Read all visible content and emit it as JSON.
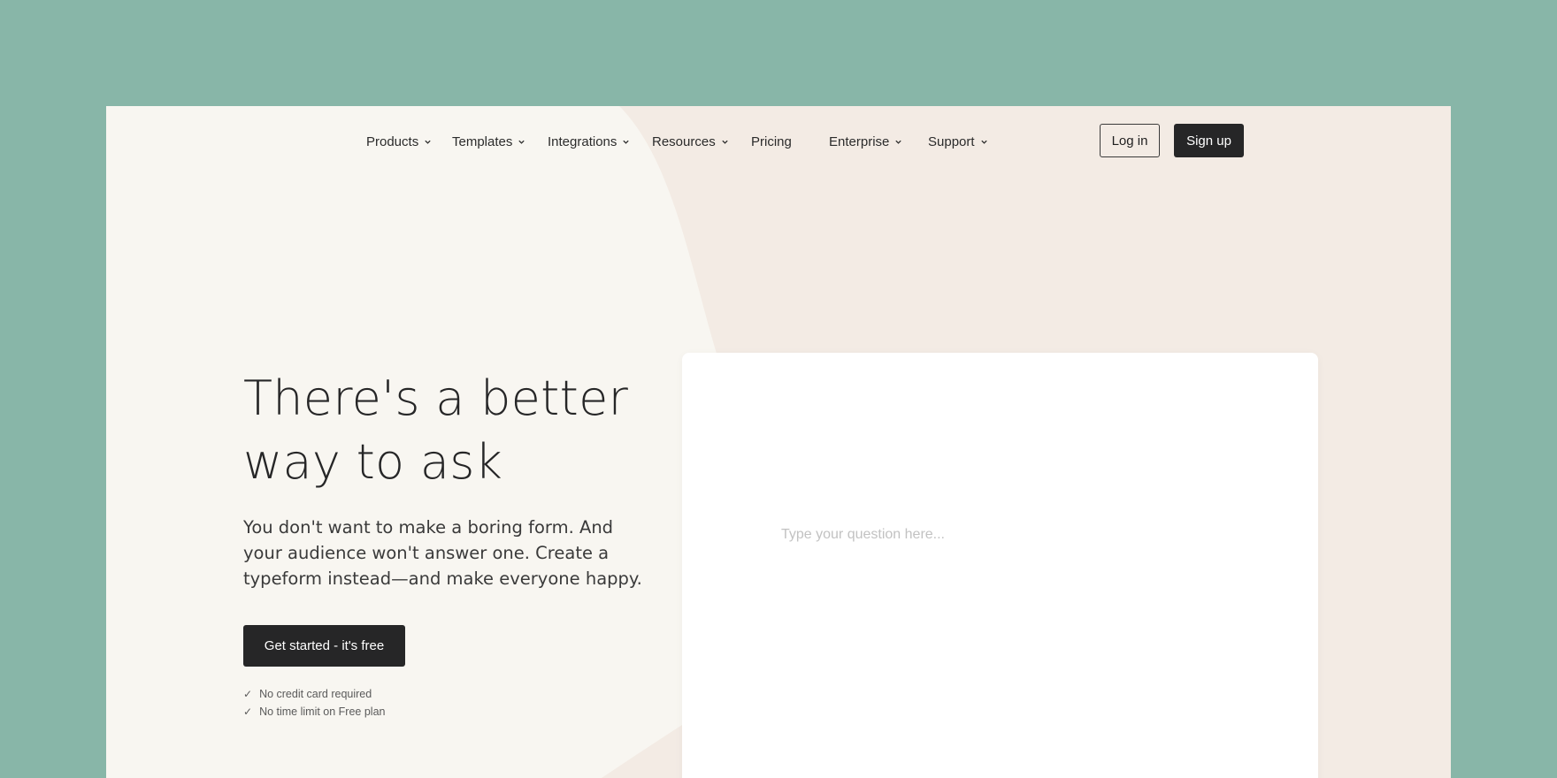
{
  "nav": {
    "items": [
      {
        "label": "Products",
        "has_dropdown": true
      },
      {
        "label": "Templates",
        "has_dropdown": true
      },
      {
        "label": "Integrations",
        "has_dropdown": true
      },
      {
        "label": "Resources",
        "has_dropdown": true
      },
      {
        "label": "Pricing",
        "has_dropdown": false
      },
      {
        "label": "Enterprise",
        "has_dropdown": true
      },
      {
        "label": "Support",
        "has_dropdown": true
      }
    ],
    "login_label": "Log in",
    "signup_label": "Sign up"
  },
  "hero": {
    "title": "There's a better way to ask",
    "subtitle": "You don't want to make a boring form. And your audience won't answer one. Create a typeform instead—and make everyone happy.",
    "cta_label": "Get started - it's free",
    "checks": [
      "No credit card required",
      "No time limit on Free plan"
    ]
  },
  "card": {
    "question_placeholder": "Type your question here..."
  },
  "colors": {
    "outer_background": "#88b6a8",
    "page_background": "#f8f6f1",
    "accent_shape": "#f3ebe4",
    "dark_button": "#262627"
  },
  "icons": {
    "dropdown": "chevron-down-icon",
    "check": "check-icon"
  }
}
